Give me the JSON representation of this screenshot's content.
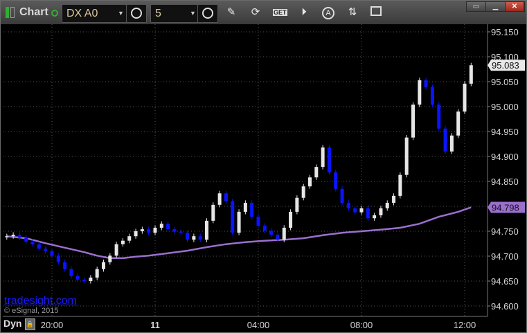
{
  "toolbar": {
    "title": "Chart",
    "symbol": "DX A0",
    "interval": "5",
    "get_label": "GET",
    "alert_label": "A",
    "icons": [
      "chart-grip-icon",
      "connection-status-icon",
      "symbol-settings-icon",
      "interval-clock-icon",
      "pencil-icon",
      "refresh-icon",
      "get-icon",
      "play-icon",
      "alert-icon",
      "link-icon",
      "comment-icon"
    ]
  },
  "window_buttons": [
    "dock-icon",
    "minimize-icon",
    "maximize-icon",
    "close-icon"
  ],
  "colors": {
    "up": "#e6e6e6",
    "down": "#0a14ff",
    "ma": "#9b6fd0",
    "last_tag": "#e8e8e8",
    "ma_tag": "#9b6fd0",
    "grid": "#555555",
    "link": "#1a1aff",
    "close_button": "#c0392b"
  },
  "watermark": {
    "link": "tradesight.com",
    "copyright": "© eSignal, 2015"
  },
  "bottom": {
    "mode": "Dyn"
  },
  "chart_data": {
    "type": "candlestick",
    "symbol": "DX A0",
    "interval": "5",
    "ylim": [
      94.585,
      95.165
    ],
    "y_ticks": [
      "95.150",
      "95.100",
      "95.050",
      "95.000",
      "94.950",
      "94.900",
      "94.850",
      "94.800",
      "94.750",
      "94.700",
      "94.650",
      "94.600"
    ],
    "x_ticks": [
      {
        "label": "20:00",
        "time": "20:00"
      },
      {
        "label": "11",
        "time": "00:00"
      },
      {
        "label": "04:00",
        "time": "04:00"
      },
      {
        "label": "08:00",
        "time": "08:00"
      },
      {
        "label": "12:00",
        "time": "12:00"
      }
    ],
    "grid": true,
    "last_price": "95.083",
    "ma_last": "94.798",
    "times": [
      "18:15",
      "18:30",
      "18:45",
      "19:00",
      "19:15",
      "19:30",
      "19:45",
      "20:00",
      "20:15",
      "20:30",
      "20:45",
      "21:00",
      "21:15",
      "21:30",
      "21:45",
      "22:00",
      "22:15",
      "22:30",
      "22:45",
      "23:00",
      "23:15",
      "23:30",
      "23:45",
      "00:00",
      "00:15",
      "00:30",
      "00:45",
      "01:00",
      "01:15",
      "01:30",
      "01:45",
      "02:00",
      "02:15",
      "02:30",
      "02:45",
      "03:00",
      "03:15",
      "03:30",
      "03:45",
      "04:00",
      "04:15",
      "04:30",
      "04:45",
      "05:00",
      "05:15",
      "05:30",
      "05:45",
      "06:00",
      "06:15",
      "06:30",
      "06:45",
      "07:00",
      "07:15",
      "07:30",
      "07:45",
      "08:00",
      "08:15",
      "08:30",
      "08:45",
      "09:00",
      "09:15",
      "09:30",
      "09:45",
      "10:00",
      "10:15",
      "10:30",
      "10:45",
      "11:00",
      "11:15",
      "11:30",
      "11:45",
      "12:00",
      "12:15"
    ],
    "closes": [
      94.74,
      94.743,
      94.737,
      94.729,
      94.724,
      94.715,
      94.71,
      94.701,
      94.688,
      94.674,
      94.66,
      94.653,
      94.65,
      94.657,
      94.674,
      94.688,
      94.701,
      94.724,
      94.731,
      94.74,
      94.75,
      94.754,
      94.747,
      94.757,
      94.765,
      94.754,
      94.749,
      94.747,
      94.733,
      94.74,
      94.733,
      94.771,
      94.803,
      94.826,
      94.81,
      94.747,
      94.789,
      94.807,
      94.779,
      94.761,
      94.751,
      94.743,
      94.733,
      94.757,
      94.789,
      94.817,
      94.84,
      94.858,
      94.879,
      94.918,
      94.868,
      94.835,
      94.807,
      94.796,
      94.788,
      94.796,
      94.776,
      94.782,
      94.796,
      94.807,
      94.821,
      94.863,
      94.938,
      95.004,
      95.053,
      95.039,
      95.004,
      94.956,
      94.91,
      94.942,
      94.99,
      95.046,
      95.083
    ],
    "moving_average": {
      "times": [
        "18:15",
        "19:00",
        "19:45",
        "20:30",
        "21:15",
        "21:45",
        "22:15",
        "22:45",
        "23:15",
        "23:45",
        "00:30",
        "01:15",
        "02:00",
        "02:45",
        "03:30",
        "04:15",
        "05:00",
        "05:45",
        "06:30",
        "07:15",
        "08:00",
        "08:45",
        "09:30",
        "10:15",
        "11:00",
        "11:45",
        "12:15"
      ],
      "values": [
        94.74,
        94.736,
        94.726,
        94.717,
        94.708,
        94.701,
        94.696,
        94.696,
        94.699,
        94.701,
        94.706,
        94.711,
        94.718,
        94.724,
        94.728,
        94.731,
        94.733,
        94.736,
        94.742,
        94.747,
        94.75,
        94.753,
        94.757,
        94.765,
        94.779,
        94.789,
        94.798
      ]
    }
  }
}
